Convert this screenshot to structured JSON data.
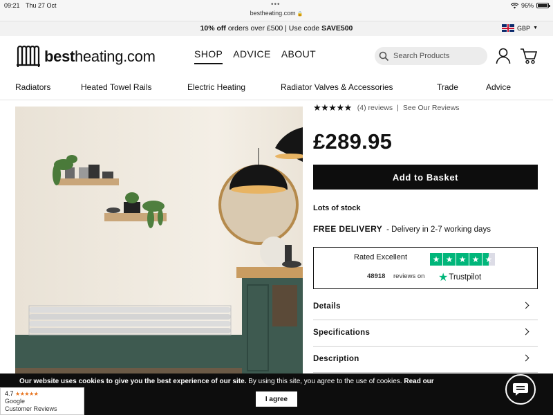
{
  "status_bar": {
    "time": "09:21",
    "date": "Thu 27 Oct",
    "url": "bestheating.com",
    "battery": "96%"
  },
  "promo": {
    "offer_bold": "10% off",
    "offer_rest": " orders over £500 | Use code ",
    "code": "SAVE500",
    "currency": "GBP"
  },
  "header": {
    "logo_bold": "best",
    "logo_rest": "heating.com",
    "nav": [
      "SHOP",
      "ADVICE",
      "ABOUT"
    ],
    "search_placeholder": "Search Products"
  },
  "categories": [
    "Radiators",
    "Heated Towel Rails",
    "Electric Heating",
    "Radiator Valves & Accessories",
    "Trade",
    "Advice"
  ],
  "product": {
    "stars": "★★★★★",
    "reviews": "(4) reviews",
    "see_reviews": "See Our Reviews",
    "price": "£289.95",
    "add_to_basket": "Add to Basket",
    "stock": "Lots of stock",
    "delivery_label": "FREE DELIVERY",
    "delivery_detail": "- Delivery in 2-7 working days"
  },
  "trustpilot": {
    "rated": "Rated Excellent",
    "count": "48918",
    "reviews_on": "reviews on",
    "brand": "Trustpilot",
    "rating_fraction": 0.9
  },
  "accordion": [
    "Details",
    "Specifications",
    "Description"
  ],
  "cookie": {
    "bold": "Our website uses cookies to give you the best experience of our site.",
    "rest": " By using this site, you agree to the use of cookies. ",
    "read_more": "Read our",
    "agree": "I agree"
  },
  "google_badge": {
    "rating": "4.7",
    "stars": "★★★★★",
    "line1": "Google",
    "line2": "Customer Reviews"
  },
  "colors": {
    "accent_dark": "#0d0d0d",
    "trustpilot_green": "#00b67a"
  }
}
